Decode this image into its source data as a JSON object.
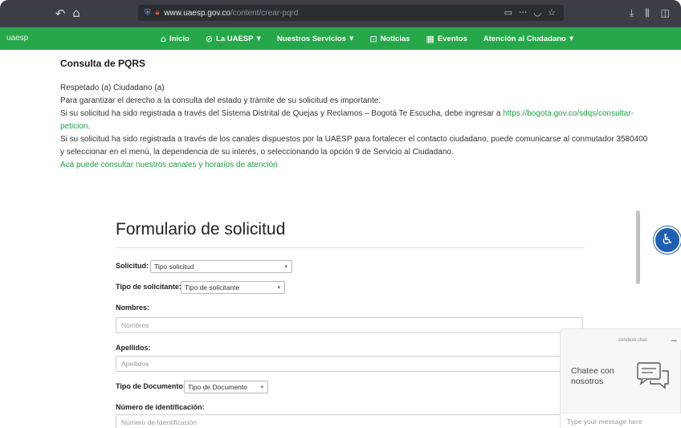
{
  "browser": {
    "url_domain": "www.uaesp.gov.co",
    "url_path": "/content/crear-pqrd",
    "icons": [
      "back-arrow-icon",
      "home-icon",
      "shield-icon",
      "lock-icon",
      "reader-icon",
      "more-icon",
      "pocket-icon",
      "star-icon",
      "download-icon",
      "library-icon",
      "sidebar-icon"
    ]
  },
  "site_nav": {
    "logo_text": "uaesp",
    "items": [
      {
        "label": "Inicio",
        "icon": "home-icon",
        "dropdown": false
      },
      {
        "label": "La UAESP",
        "icon": "check-circle-icon",
        "dropdown": true
      },
      {
        "label": "Nuestros Servicios",
        "icon": "",
        "dropdown": true
      },
      {
        "label": "Noticias",
        "icon": "news-icon",
        "dropdown": false
      },
      {
        "label": "Eventos",
        "icon": "calendar-icon",
        "dropdown": false
      },
      {
        "label": "Atención al Ciudadano",
        "icon": "",
        "dropdown": true
      }
    ],
    "background": "#26a84a"
  },
  "content": {
    "heading": "Consulta de PQRS",
    "greeting": "Respetado (a) Ciudadano (a)",
    "line1": "Para garantizar el derecho a la consulta del estado y trámite de su solicitud es importante:",
    "line2_text": "Si su solicitud ha sido registrada a través del Sistema Distrital de Quejas y Reclamos – Bogotá Te Escucha, debe ingresar a",
    "line2_link_a": "https://bogota.gov.co/sdqs/consultar-",
    "line2_link_b": "peticion",
    "line2_end": ".",
    "line3": "Si su solicitud ha sido registrada a través de los canales dispuestos por la UAESP para fortalecer el contacto ciudadano, puede comunicarse al conmutador 3580400",
    "line4": "y seleccionar en el menú, la dependencia de su interés, o seleccionando la opción 9 de Servicio al Ciudadano.",
    "channels_link": "Acá puede consultar nuestros canales y horarios de atención",
    "link_color": "#1d9e45"
  },
  "form": {
    "title": "Formulario de solicitud",
    "solicitud_label": "Solicitud:",
    "solicitud_value": "Tipo solicitud",
    "solicitante_label": "Tipo de solicitante:",
    "solicitante_value": "Tipo de solicitante",
    "nombres_label": "Nombres:",
    "nombres_placeholder": "Nombres",
    "apellidos_label": "Apellidos:",
    "apellidos_placeholder": "Apellidos",
    "documento_label": "Tipo de Documento:",
    "documento_value": "Tipo de Documento",
    "identificacion_label": "Número de identificación:",
    "identificacion_placeholder": "Número de Identificación"
  },
  "accessibility": {
    "icon": "wheelchair-icon",
    "color": "#1f5fb3"
  },
  "chat": {
    "brand": "zendesk chat",
    "minimize": "–",
    "invite_text": "Chatee con nosotros",
    "input_placeholder": "Type your message here",
    "icon": "chat-bubbles-icon"
  }
}
